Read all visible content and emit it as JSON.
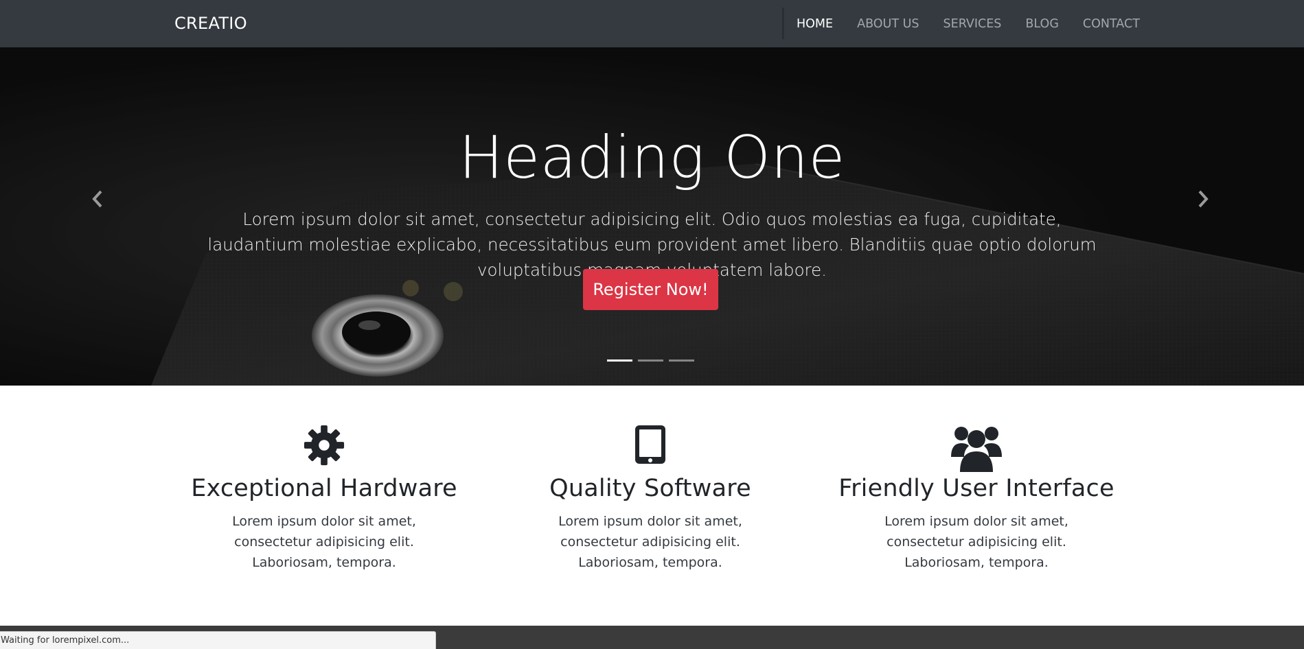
{
  "navbar": {
    "brand": "CREATIO",
    "links": [
      {
        "label": "HOME",
        "active": true
      },
      {
        "label": "ABOUT US",
        "active": false
      },
      {
        "label": "SERVICES",
        "active": false
      },
      {
        "label": "BLOG",
        "active": false
      },
      {
        "label": "CONTACT",
        "active": false
      }
    ]
  },
  "hero": {
    "heading": "Heading One",
    "text": "Lorem ipsum dolor sit amet, consectetur adipisicing elit. Odio quos molestias ea fuga, cupiditate, laudantium molestiae explicabo, necessitatibus eum provident amet libero. Blanditiis quae optio dolorum voluptatibus magnam voluptatem labore.",
    "button_label": "Register Now!",
    "slide_count": 3,
    "active_slide": 1,
    "prev_icon": "chevron-left-icon",
    "next_icon": "chevron-right-icon"
  },
  "features": [
    {
      "icon": "gear-icon",
      "title": "Exceptional Hardware",
      "text": "Lorem ipsum dolor sit amet, consectetur adipisicing elit. Laboriosam, tempora."
    },
    {
      "icon": "tablet-icon",
      "title": "Quality Software",
      "text": "Lorem ipsum dolor sit amet, consectetur adipisicing elit. Laboriosam, tempora."
    },
    {
      "icon": "users-icon",
      "title": "Friendly User Interface",
      "text": "Lorem ipsum dolor sit amet, consectetur adipisicing elit. Laboriosam, tempora."
    }
  ],
  "status_bar": {
    "text": "Waiting for lorempixel.com..."
  },
  "colors": {
    "navbar_bg": "#343a40",
    "accent_button": "#dc3545",
    "footer_bg": "#3b3b3b"
  }
}
